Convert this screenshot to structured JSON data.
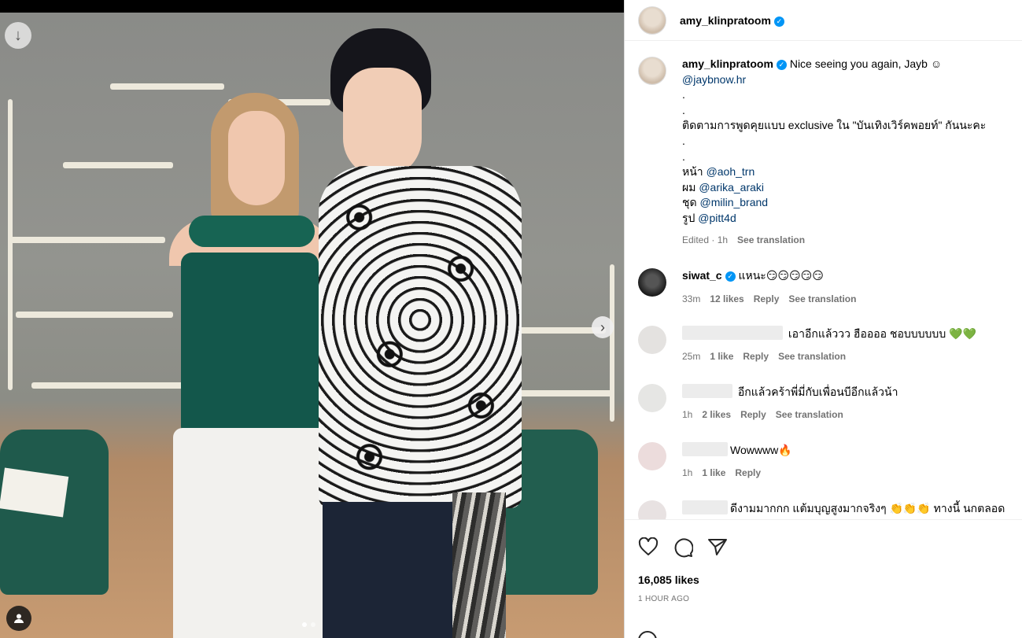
{
  "post": {
    "author": "amy_klinpratoom",
    "likes": "16,085 likes",
    "time": "1 HOUR AGO",
    "slides_count": 2,
    "active_slide": 1
  },
  "caption": {
    "username": "amy_klinpratoom",
    "text_intro": "Nice seeing you again, Jayb ☺︎",
    "mention_1": "@jaybnow.hr",
    "dot_1": ".",
    "dot_2": ".",
    "line_exclusive": "ติดตามการพูดคุยแบบ exclusive ใน \"บันเทิงเวิร์คพอยท์\" กันนะคะ",
    "dot_3": ".",
    "dot_4": ".",
    "credit_face_label": "หน้า",
    "credit_face": "@aoh_trn",
    "credit_hair_label": "ผม",
    "credit_hair": "@arika_araki",
    "credit_outfit_label": "ชุด",
    "credit_outfit": "@milin_brand",
    "credit_photo_label": "รูป",
    "credit_photo": "@pitt4d",
    "edited": "Edited · 1h",
    "see_translation": "See translation"
  },
  "comments": [
    {
      "user": "siwat_c",
      "verified": true,
      "text": "แหนะ😏😏😏😏😏",
      "time": "33m",
      "likes": "12 likes",
      "reply": "Reply",
      "translate": "See translation"
    },
    {
      "user": "",
      "text": "เอาอีกแล้ววว ฮืออออ ชอบบบบบบ 💚💚",
      "time": "25m",
      "likes": "1 like",
      "reply": "Reply",
      "translate": "See translation"
    },
    {
      "user": "",
      "text": "อีกแล้วคร้าพี่มี่กับเพื่อนบีอีกแล้วน้า",
      "time": "1h",
      "likes": "2 likes",
      "reply": "Reply",
      "translate": "See translation"
    },
    {
      "user": "",
      "text": "Wowwww🔥",
      "time": "1h",
      "likes": "1 like",
      "reply": "Reply"
    },
    {
      "user": "",
      "text": "ดีงามมากกก แต้มบุญสูงมากจริงๆ 👏👏👏 ทางนี้ นกตลอด"
    }
  ],
  "icons": {
    "download": "arrow-down-icon",
    "next": "chevron-right-icon",
    "tags": "user-tag-icon",
    "like": "heart-icon",
    "comment": "comment-icon",
    "share": "send-icon",
    "verified": "verified-badge-icon"
  },
  "colors": {
    "verified": "#0095f6",
    "link": "#00376b",
    "muted": "#737373"
  }
}
